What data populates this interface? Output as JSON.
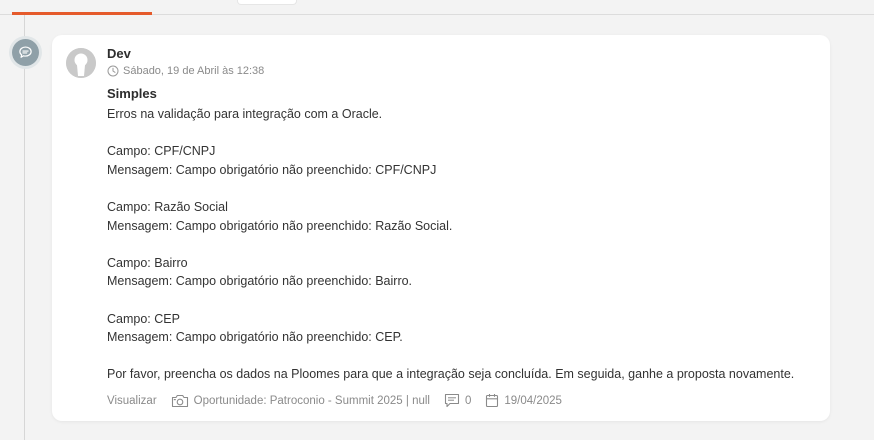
{
  "note": {
    "author": "Dev",
    "timestamp": "Sábado, 19 de Abril às 12:38",
    "subject": "Simples",
    "body_lines": [
      "Erros na validação para integração com a Oracle.",
      "",
      "Campo: CPF/CNPJ",
      "Mensagem: Campo obrigatório não preenchido: CPF/CNPJ",
      "",
      "Campo: Razão Social",
      "Mensagem: Campo obrigatório não preenchido: Razão Social.",
      "",
      "Campo: Bairro",
      "Mensagem: Campo obrigatório não preenchido: Bairro.",
      "",
      "Campo: CEP",
      "Mensagem: Campo obrigatório não preenchido: CEP.",
      "",
      "Por favor, preencha os dados na Ploomes para que a integração seja concluída. Em seguida, ganhe a proposta novamente."
    ],
    "footer": {
      "view_label": "Visualizar",
      "deal_label": "Oportunidade: Patroconio - Summit 2025 | null",
      "comment_count": "0",
      "date": "19/04/2025"
    }
  },
  "colors": {
    "accent": "#e55a2b",
    "marker": "#8fa0a8",
    "muted_text": "#8a8a8a",
    "card_bg": "#ffffff",
    "page_bg": "#f3f3f3"
  },
  "icons": {
    "timeline_marker": "chat-bubble-icon",
    "timestamp": "clock-icon",
    "deal": "camera-icon",
    "comments": "comment-icon",
    "date": "calendar-icon"
  }
}
